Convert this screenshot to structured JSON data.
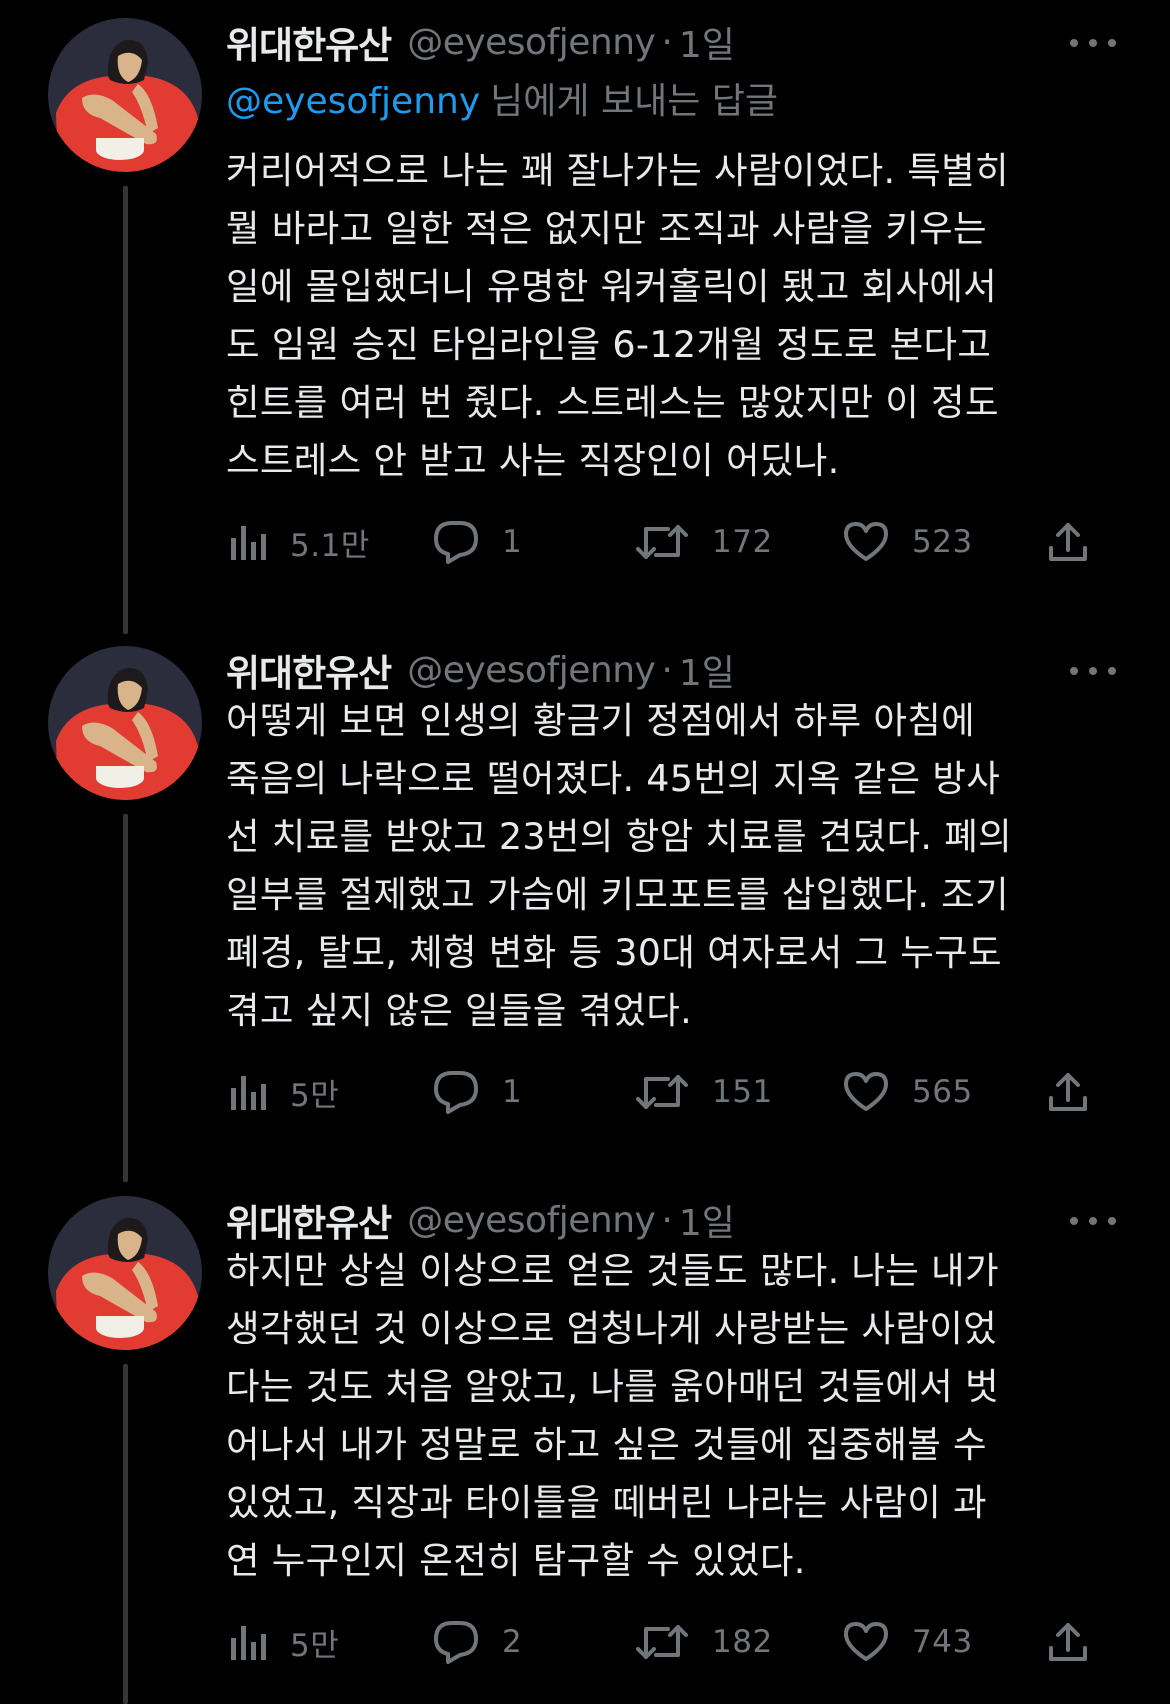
{
  "colors": {
    "background": "#000000",
    "text_primary": "#e7e9ea",
    "text_secondary": "#71767b",
    "link": "#1d9bf0",
    "avatar_red": "#e23b31"
  },
  "icons": {
    "views": "bar-chart-icon",
    "reply": "speech-bubble-icon",
    "retweet": "retweet-arrows-icon",
    "like": "heart-icon",
    "share": "upload-share-icon",
    "more": "three-dots-icon"
  },
  "tweets": [
    {
      "author_name": "위대한유산",
      "handle": "@eyesofjenny",
      "separator": "·",
      "time": "1일",
      "reply_to_mention": "@eyesofjenny",
      "reply_to_suffix": "님에게 보내는 답글",
      "lines": [
        "커리어적으로 나는 꽤 잘나가는 사람이었다. 특별히",
        "뭘 바라고 일한 적은 없지만 조직과 사람을 키우는",
        "일에 몰입했더니 유명한 워커홀릭이 됐고 회사에서",
        "도 임원 승진 타임라인을 6-12개월 정도로 본다고",
        "힌트를 여러 번 줬다. 스트레스는 많았지만 이 정도",
        "스트레스 안 받고 사는 직장인이 어딨나."
      ],
      "views": "5.1만",
      "replies": "1",
      "retweets": "172",
      "likes": "523"
    },
    {
      "author_name": "위대한유산",
      "handle": "@eyesofjenny",
      "separator": "·",
      "time": "1일",
      "lines": [
        "어떻게 보면 인생의 황금기 정점에서 하루 아침에",
        "죽음의 나락으로 떨어졌다. 45번의 지옥 같은 방사",
        "선 치료를 받았고 23번의 항암 치료를 견뎠다. 폐의",
        "일부를 절제했고 가슴에 키모포트를 삽입했다. 조기",
        "폐경, 탈모, 체형 변화 등 30대 여자로서 그 누구도",
        "겪고 싶지 않은 일들을 겪었다."
      ],
      "views": "5만",
      "replies": "1",
      "retweets": "151",
      "likes": "565"
    },
    {
      "author_name": "위대한유산",
      "handle": "@eyesofjenny",
      "separator": "·",
      "time": "1일",
      "lines": [
        "하지만 상실 이상으로 얻은 것들도 많다. 나는 내가",
        "생각했던 것 이상으로 엄청나게 사랑받는 사람이었",
        "다는 것도 처음 알았고, 나를 옭아매던 것들에서 벗",
        "어나서 내가 정말로 하고 싶은 것들에 집중해볼 수",
        "있었고, 직장과 타이틀을 떼버린 나라는 사람이 과",
        "연 누구인지 온전히 탐구할 수 있었다."
      ],
      "views": "5만",
      "replies": "2",
      "retweets": "182",
      "likes": "743"
    }
  ]
}
